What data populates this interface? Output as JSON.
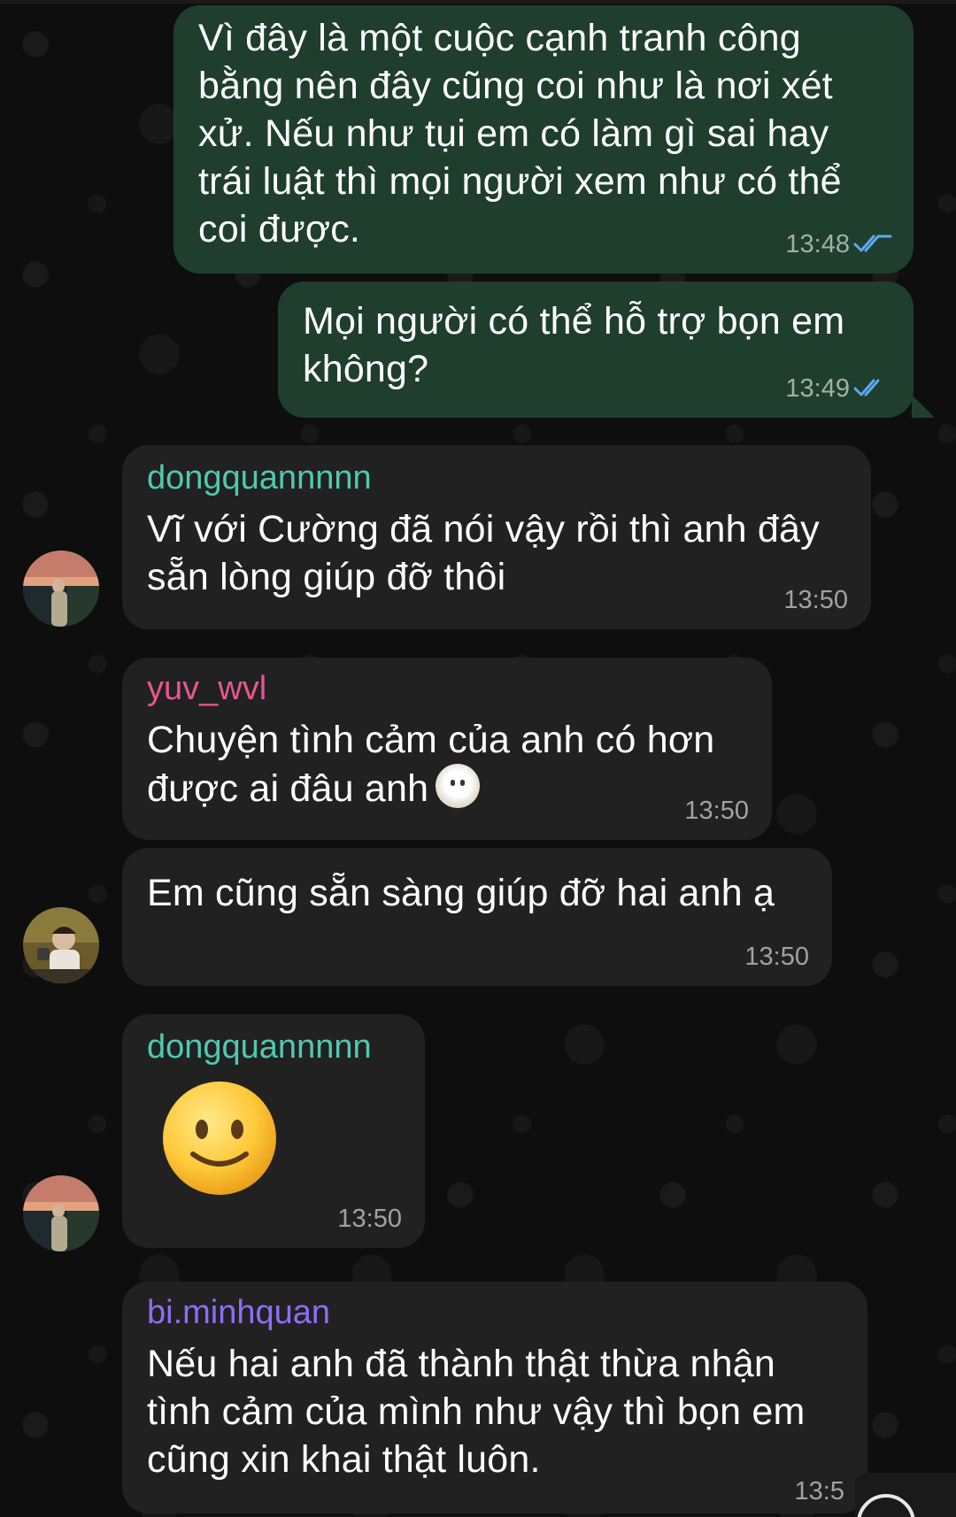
{
  "messages": [
    {
      "kind": "outgoing",
      "text": "Vì đây là một cuộc cạnh tranh công bằng nên đây cũng coi như là nơi xét xử. Nếu như tụi em có làm gì sai hay trái luật thì mọi người xem như có thể coi được.",
      "time": "13:48",
      "status": "read"
    },
    {
      "kind": "outgoing",
      "text": "Mọi người có thể hỗ trợ bọn em không?",
      "time": "13:49",
      "status": "read"
    },
    {
      "kind": "incoming",
      "sender": "dongquannnnn",
      "sender_color": "#4fc9b0",
      "text": "Vĩ với Cường đã nói vậy rồi thì anh đây sẵn lòng giúp đỡ thôi",
      "time": "13:50"
    },
    {
      "kind": "incoming",
      "sender": "yuv_wvl",
      "sender_color": "#e6578f",
      "text": "Chuyện tình cảm của anh có hơn được ai đâu anh",
      "emoji": "smiling-face-in-clouds",
      "time": "13:50"
    },
    {
      "kind": "incoming",
      "text": "Em cũng sẵn sàng giúp đỡ hai anh ạ",
      "time": "13:50"
    },
    {
      "kind": "incoming",
      "sender": "dongquannnnn",
      "sender_color": "#4fc9b0",
      "emoji": "slightly-smiling-face",
      "time": "13:50"
    },
    {
      "kind": "incoming",
      "sender": "bi.minhquan",
      "sender_color": "#8f6cf5",
      "text": "Nếu hai anh đã thành thật thừa nhận tình cảm của mình như vậy thì bọn em cũng xin khai thật luôn.",
      "time": "13:5"
    }
  ],
  "colors": {
    "outgoing_bubble": "#1f3e2d",
    "incoming_bubble": "#212121",
    "read_ticks": "#5aa9f0",
    "background": "#0e0e0e"
  },
  "icons": {
    "read_ticks": "double-check-icon",
    "compose_button": "circle-button-icon"
  }
}
